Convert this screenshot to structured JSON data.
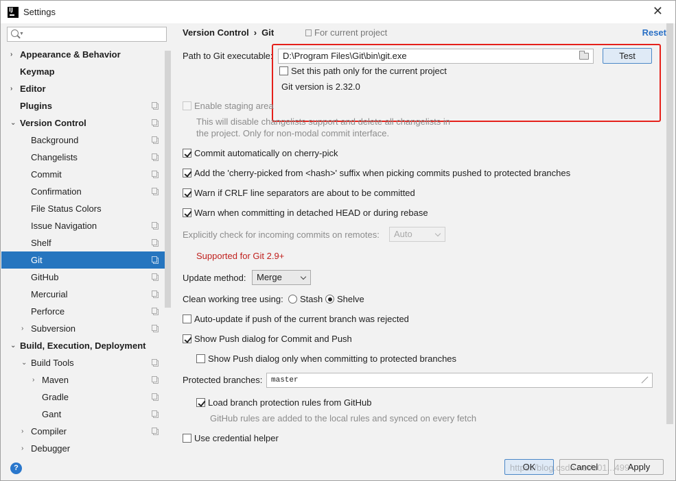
{
  "window": {
    "title": "Settings",
    "close": "✕"
  },
  "sidebar": {
    "search_placeholder": "",
    "items": [
      {
        "label": "Appearance & Behavior",
        "bold": true,
        "arrow": "›",
        "proj": false
      },
      {
        "label": "Keymap",
        "bold": true,
        "arrow": "",
        "proj": false
      },
      {
        "label": "Editor",
        "bold": true,
        "arrow": "›",
        "proj": false
      },
      {
        "label": "Plugins",
        "bold": true,
        "arrow": "",
        "proj": true
      },
      {
        "label": "Version Control",
        "bold": true,
        "arrow": "⌄",
        "proj": true
      },
      {
        "label": "Background",
        "proj": true
      },
      {
        "label": "Changelists",
        "proj": true
      },
      {
        "label": "Commit",
        "proj": true
      },
      {
        "label": "Confirmation",
        "proj": true
      },
      {
        "label": "File Status Colors",
        "proj": false
      },
      {
        "label": "Issue Navigation",
        "proj": true
      },
      {
        "label": "Shelf",
        "proj": true
      },
      {
        "label": "Git",
        "proj": true,
        "selected": true
      },
      {
        "label": "GitHub",
        "proj": true
      },
      {
        "label": "Mercurial",
        "proj": true
      },
      {
        "label": "Perforce",
        "proj": true
      },
      {
        "label": "Subversion",
        "arrow": "›",
        "proj": true
      },
      {
        "label": "Build, Execution, Deployment",
        "bold": true,
        "arrow": "⌄",
        "proj": false
      },
      {
        "label": "Build Tools",
        "arrow": "⌄",
        "proj": true
      },
      {
        "label": "Maven",
        "arrow": "›",
        "proj": true
      },
      {
        "label": "Gradle",
        "proj": true
      },
      {
        "label": "Gant",
        "proj": true
      },
      {
        "label": "Compiler",
        "arrow": "›",
        "proj": true
      },
      {
        "label": "Debugger",
        "arrow": "›",
        "proj": false
      }
    ]
  },
  "header": {
    "crumb_parent": "Version Control",
    "crumb_sep": "›",
    "crumb_current": "Git",
    "scope": "For current project",
    "reset": "Reset"
  },
  "git": {
    "path_label": "Path to Git executable:",
    "path_value": "D:\\Program Files\\Git\\bin\\git.exe",
    "test_label": "Test",
    "current_project_only": "Set this path only for the current project",
    "version_text": "Git version is 2.32.0",
    "staging_label": "Enable staging area",
    "staging_desc_1": "This will disable changelists support and delete all changelists in",
    "staging_desc_2": "the project. Only for non-modal commit interface.",
    "cherry_pick_commit": "Commit automatically on cherry-pick",
    "cherry_pick_suffix": "Add the 'cherry-picked from <hash>' suffix when picking commits pushed to protected branches",
    "crlf_warn": "Warn if CRLF line separators are about to be committed",
    "detached_warn": "Warn when committing in detached HEAD or during rebase",
    "incoming_label": "Explicitly check for incoming commits on remotes:",
    "incoming_value": "Auto",
    "supported_note": "Supported for Git 2.9+",
    "update_label": "Update method:",
    "update_value": "Merge",
    "clean_label": "Clean working tree using:",
    "clean_stash": "Stash",
    "clean_shelve": "Shelve",
    "auto_update": "Auto-update if push of the current branch was rejected",
    "show_push_dialog": "Show Push dialog for Commit and Push",
    "show_push_protected": "Show Push dialog only when committing to protected branches",
    "protected_label": "Protected branches:",
    "protected_value": "master",
    "github_rules": "Load branch protection rules from GitHub",
    "github_rules_desc": "GitHub rules are added to the local rules and synced on every fetch",
    "credential_helper": "Use credential helper"
  },
  "footer": {
    "help": "?",
    "ok": "OK",
    "cancel": "Cancel",
    "apply": "Apply",
    "watermark": "https://blog.csdn.net/u01...499"
  }
}
